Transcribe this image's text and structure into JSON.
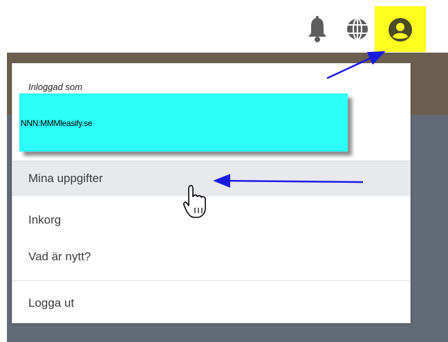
{
  "colors": {
    "highlight": "#ffff1f",
    "account_box": "#2cfff8",
    "header_band": "#6b5f4f",
    "content_bg": "#636b76",
    "annotation_arrow": "#1a1ae6",
    "hover_row": "#e8e9ec"
  },
  "topbar": {
    "icons": [
      "bell-icon",
      "globe-icon",
      "user-circle-icon"
    ]
  },
  "menu": {
    "logged_in_label": "Inloggad som",
    "account_name": "NNN:MMMleasify.se",
    "items": [
      {
        "label": "Mina uppgifter"
      },
      {
        "label": "Inkorg"
      },
      {
        "label": "Vad är nytt?"
      },
      {
        "label": "Logga ut"
      }
    ]
  },
  "cursor": "hand-pointer-icon"
}
